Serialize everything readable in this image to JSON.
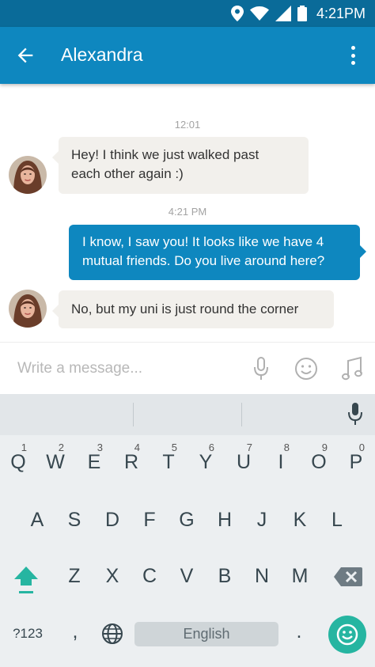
{
  "status_bar": {
    "time": "4:21PM",
    "icons": [
      "location-icon",
      "wifi-icon",
      "signal-icon",
      "battery-icon"
    ]
  },
  "app_bar": {
    "title": "Alexandra",
    "back_icon": "arrow-left-icon",
    "menu_icon": "more-vert-icon"
  },
  "conversation": {
    "messages": [
      {
        "timestamp": "12:01",
        "direction": "incoming",
        "text_lines": [
          "Hey! I think we just walked past",
          "each other again :)"
        ]
      },
      {
        "timestamp": "4:21 PM",
        "direction": "outgoing",
        "text_lines": [
          "I know, I saw you! It looks like we have 4",
          "mutual friends. Do you live around here?"
        ]
      },
      {
        "direction": "incoming",
        "text_lines": [
          "No, but my uni is just round the corner"
        ]
      }
    ]
  },
  "composer": {
    "placeholder": "Write a message...",
    "icons": [
      "microphone-icon",
      "emoji-icon",
      "music-note-icon"
    ]
  },
  "keyboard": {
    "row1": [
      {
        "key": "Q",
        "hint": "1"
      },
      {
        "key": "W",
        "hint": "2"
      },
      {
        "key": "E",
        "hint": "3"
      },
      {
        "key": "R",
        "hint": "4"
      },
      {
        "key": "T",
        "hint": "5"
      },
      {
        "key": "Y",
        "hint": "6"
      },
      {
        "key": "U",
        "hint": "7"
      },
      {
        "key": "I",
        "hint": "8"
      },
      {
        "key": "O",
        "hint": "9"
      },
      {
        "key": "P",
        "hint": "0"
      }
    ],
    "row2": [
      "A",
      "S",
      "D",
      "F",
      "G",
      "H",
      "J",
      "K",
      "L"
    ],
    "row3": [
      "Z",
      "X",
      "C",
      "V",
      "B",
      "N",
      "M"
    ],
    "symbols_key": "?123",
    "comma_key": ",",
    "space_label": "English",
    "period_key": ".",
    "colors": {
      "accent": "#26b5a1",
      "app_bar": "#0e87bf",
      "status_bar": "#0a6b99"
    }
  }
}
